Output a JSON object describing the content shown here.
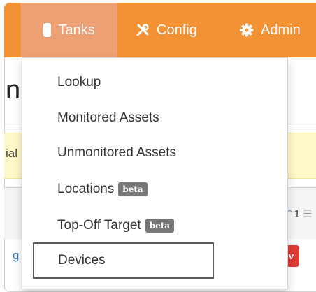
{
  "navbar": {
    "items": [
      {
        "label": "Tanks",
        "icon": "tank-icon",
        "active": true
      },
      {
        "label": "Config",
        "icon": "tools-icon"
      },
      {
        "label": "Admin",
        "icon": "gear-icon"
      }
    ]
  },
  "background": {
    "title_fragment": "n",
    "column_fragment": "ial",
    "sort_text": "1",
    "link_fragment": "g",
    "badge_fragment": "v"
  },
  "dropdown": {
    "items": [
      {
        "label": "Lookup"
      },
      {
        "label": "Monitored Assets"
      },
      {
        "label": "Unmonitored Assets"
      },
      {
        "label": "Locations",
        "badge": "beta"
      },
      {
        "label": "Top-Off Target",
        "badge": "beta"
      },
      {
        "label": "Devices",
        "focused": true
      }
    ]
  },
  "colors": {
    "navbar": "#f39234",
    "active_tab": "#eda074",
    "badge_beta": "#777777",
    "highlight_row": "#fff8c8",
    "status_badge": "#dd3b34",
    "link": "#3b72b8"
  }
}
